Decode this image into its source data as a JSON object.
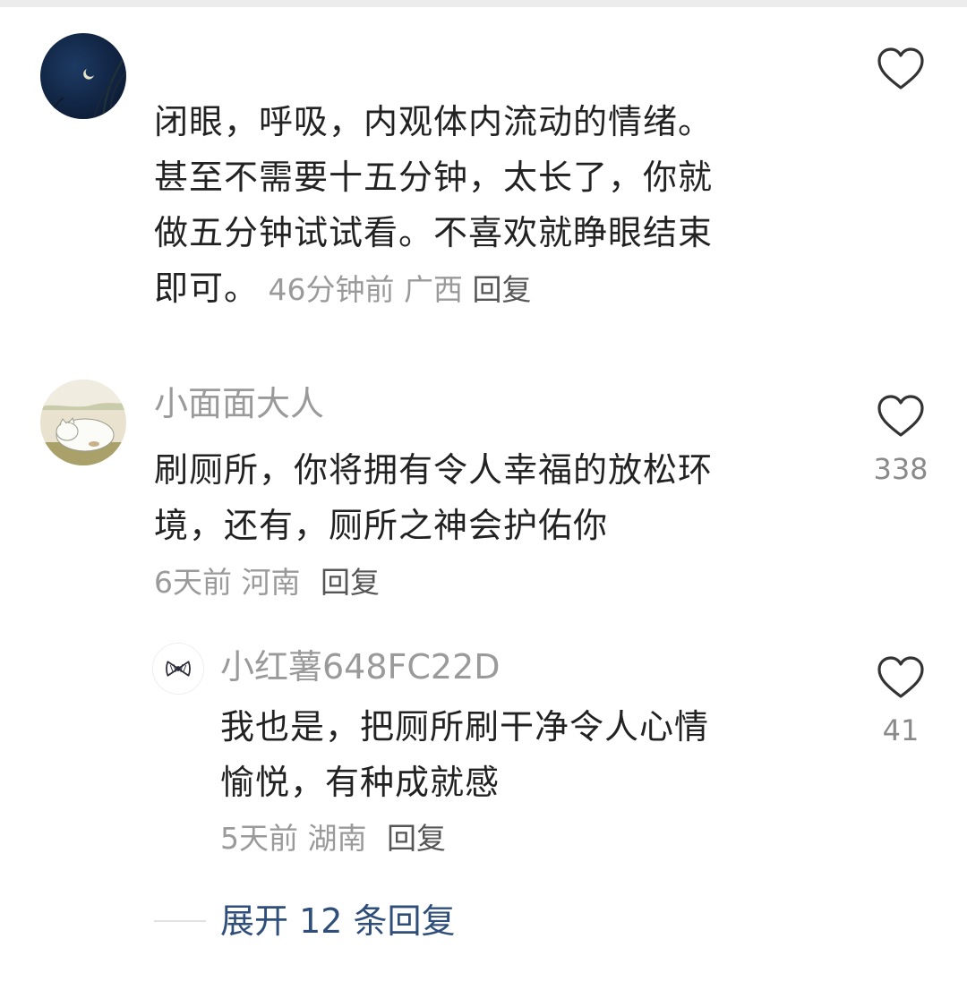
{
  "comments": [
    {
      "username": "",
      "text": "闭眼，呼吸，内观体内流动的情绪。\n甚至不需要十五分钟，太长了，你就\n做五分钟试试看。不喜欢就睁眼结束\n即可。",
      "time": "46分钟前",
      "location": "广西",
      "reply_label": "回复",
      "like_count": ""
    },
    {
      "username": "小面面大人",
      "text": "刷厕所，你将拥有令人幸福的放松环\n境，还有，厕所之神会护佑你",
      "time": "6天前",
      "location": "河南",
      "reply_label": "回复",
      "like_count": "338"
    }
  ],
  "reply": {
    "username": "小红薯648FC22D",
    "text": "我也是，把厕所刷干净令人心情\n愉悦，有种成就感",
    "time": "5天前",
    "location": "湖南",
    "reply_label": "回复",
    "like_count": "41"
  },
  "expand_label": "展开 12 条回复",
  "icons": {
    "like": "heart-outline-icon",
    "avatar1": "night-moon-avatar",
    "avatar2": "sleeping-cat-avatar",
    "avatar3": "bow-avatar"
  },
  "colors": {
    "text": "#222222",
    "meta": "#9a9a9a",
    "reply": "#555555",
    "expand": "#2f4f7a",
    "heart": "#333333"
  }
}
